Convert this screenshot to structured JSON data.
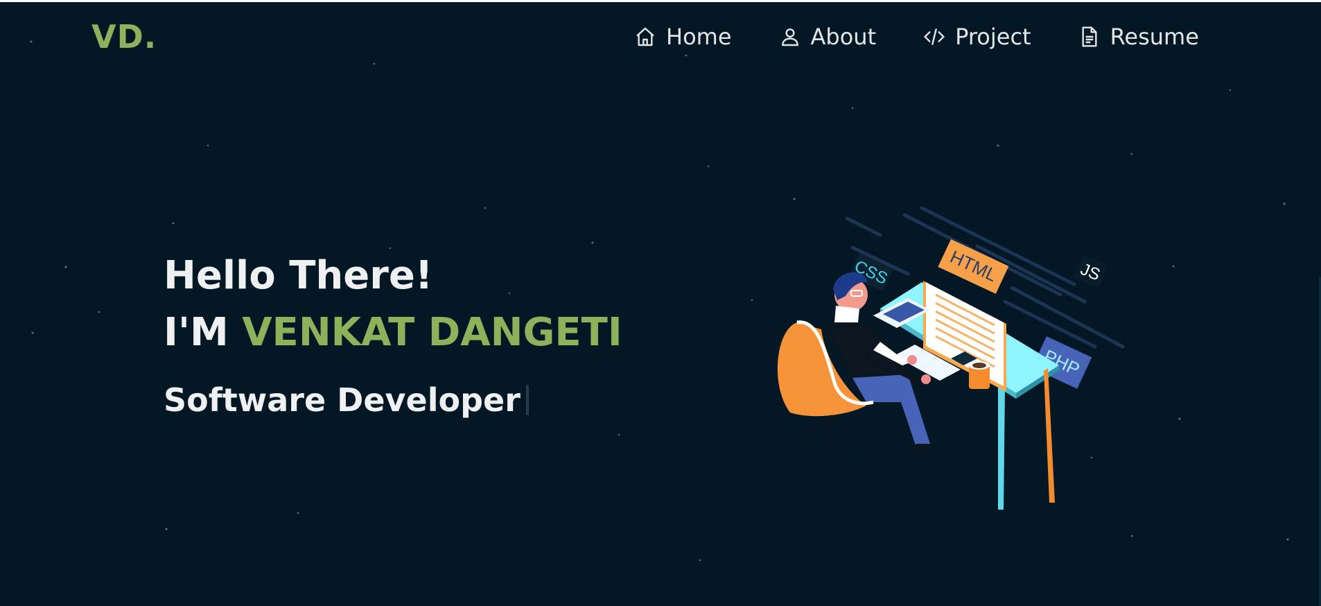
{
  "logo": {
    "text": "VD",
    "dot": "."
  },
  "nav": {
    "items": [
      {
        "label": "Home",
        "icon": "home-icon"
      },
      {
        "label": "About",
        "icon": "user-icon"
      },
      {
        "label": "Project",
        "icon": "code-icon"
      },
      {
        "label": "Resume",
        "icon": "document-icon"
      }
    ]
  },
  "hero": {
    "greeting": "Hello There!",
    "intro_prefix": "I'M",
    "name": "VENKAT DANGETI",
    "role": "Software Developer"
  },
  "illustration": {
    "tags": {
      "html": "HTML",
      "css": "CSS",
      "js": "JS",
      "php": "PHP"
    }
  },
  "colors": {
    "background": "#031724",
    "accent": "#8cb35b",
    "text": "#eef0f1"
  }
}
